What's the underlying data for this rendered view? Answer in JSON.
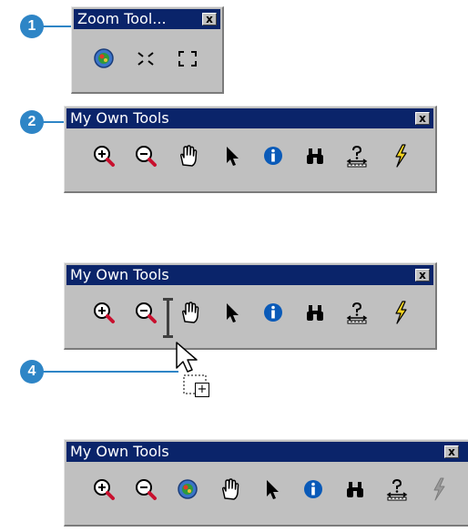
{
  "callouts": {
    "step1": "1",
    "step2": "2",
    "step4": "4"
  },
  "zoom_toolbar": {
    "title": "Zoom Tool...",
    "close": "x",
    "tools": [
      "full-extent-icon",
      "fixed-zoom-in-icon",
      "fixed-zoom-out-icon"
    ]
  },
  "toolbar_a": {
    "title": "My Own Tools",
    "close": "x",
    "tools": [
      "zoom-in-icon",
      "zoom-out-icon",
      "pan-hand-icon",
      "select-arrow-icon",
      "identify-icon",
      "find-binoculars-icon",
      "measure-icon",
      "hyperlink-lightning-icon"
    ]
  },
  "toolbar_b": {
    "title": "My Own Tools",
    "close": "x",
    "tools": [
      "zoom-in-icon",
      "zoom-out-icon",
      "insertion-bar",
      "pan-hand-icon",
      "select-arrow-icon",
      "identify-icon",
      "find-binoculars-icon",
      "measure-icon",
      "hyperlink-lightning-icon"
    ]
  },
  "toolbar_c": {
    "title": "My Own Tools",
    "close": "x",
    "tools": [
      "zoom-in-icon",
      "zoom-out-icon",
      "full-extent-icon",
      "pan-hand-icon",
      "select-arrow-icon",
      "identify-icon",
      "find-binoculars-icon",
      "measure-icon",
      "hyperlink-lightning-icon"
    ]
  },
  "drag_cursor": {
    "icon": "drag-copy-cursor-icon",
    "badge": "+"
  },
  "colors": {
    "titlebar": "#0a246a",
    "face": "#c0c0c0",
    "callout": "#2e85c6"
  }
}
